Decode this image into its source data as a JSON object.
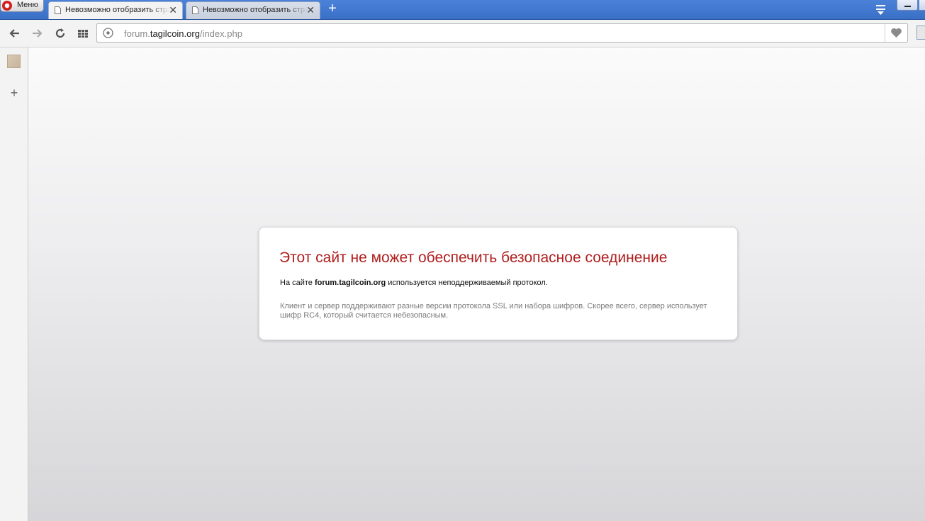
{
  "browser": {
    "menu_label": "Меню",
    "tabs": [
      {
        "title": "Невозможно отобразить страницу",
        "close": "✕",
        "active": true
      },
      {
        "title": "Невозможно отобразить страницу",
        "close": "✕",
        "active": false
      }
    ],
    "new_tab": "+",
    "address": {
      "prefix": "forum.",
      "domain": "tagilcoin.org",
      "path": "/index.php"
    },
    "sidebar_add": "+"
  },
  "error": {
    "title": "Этот сайт не может обеспечить безопасное соединение",
    "line_prefix": "На сайте ",
    "line_domain": "forum.tagilcoin.org",
    "line_suffix": " используется неподдерживаемый протокол.",
    "detail": "Клиент и сервер поддерживают разные версии протокола SSL или набора шифров. Скорее всего, сервер использует шифр RC4, который считается небезопасным."
  },
  "colors": {
    "titlebar": "#3a6fc6",
    "error_title": "#b11e1e",
    "detail_text": "#7a7a7a"
  },
  "icons": [
    "opera-logo-icon",
    "document-icon",
    "close-icon",
    "plus-icon",
    "tab-menu-icon",
    "back-icon",
    "forward-icon",
    "reload-icon",
    "speed-dial-icon",
    "site-info-icon",
    "heart-icon"
  ]
}
